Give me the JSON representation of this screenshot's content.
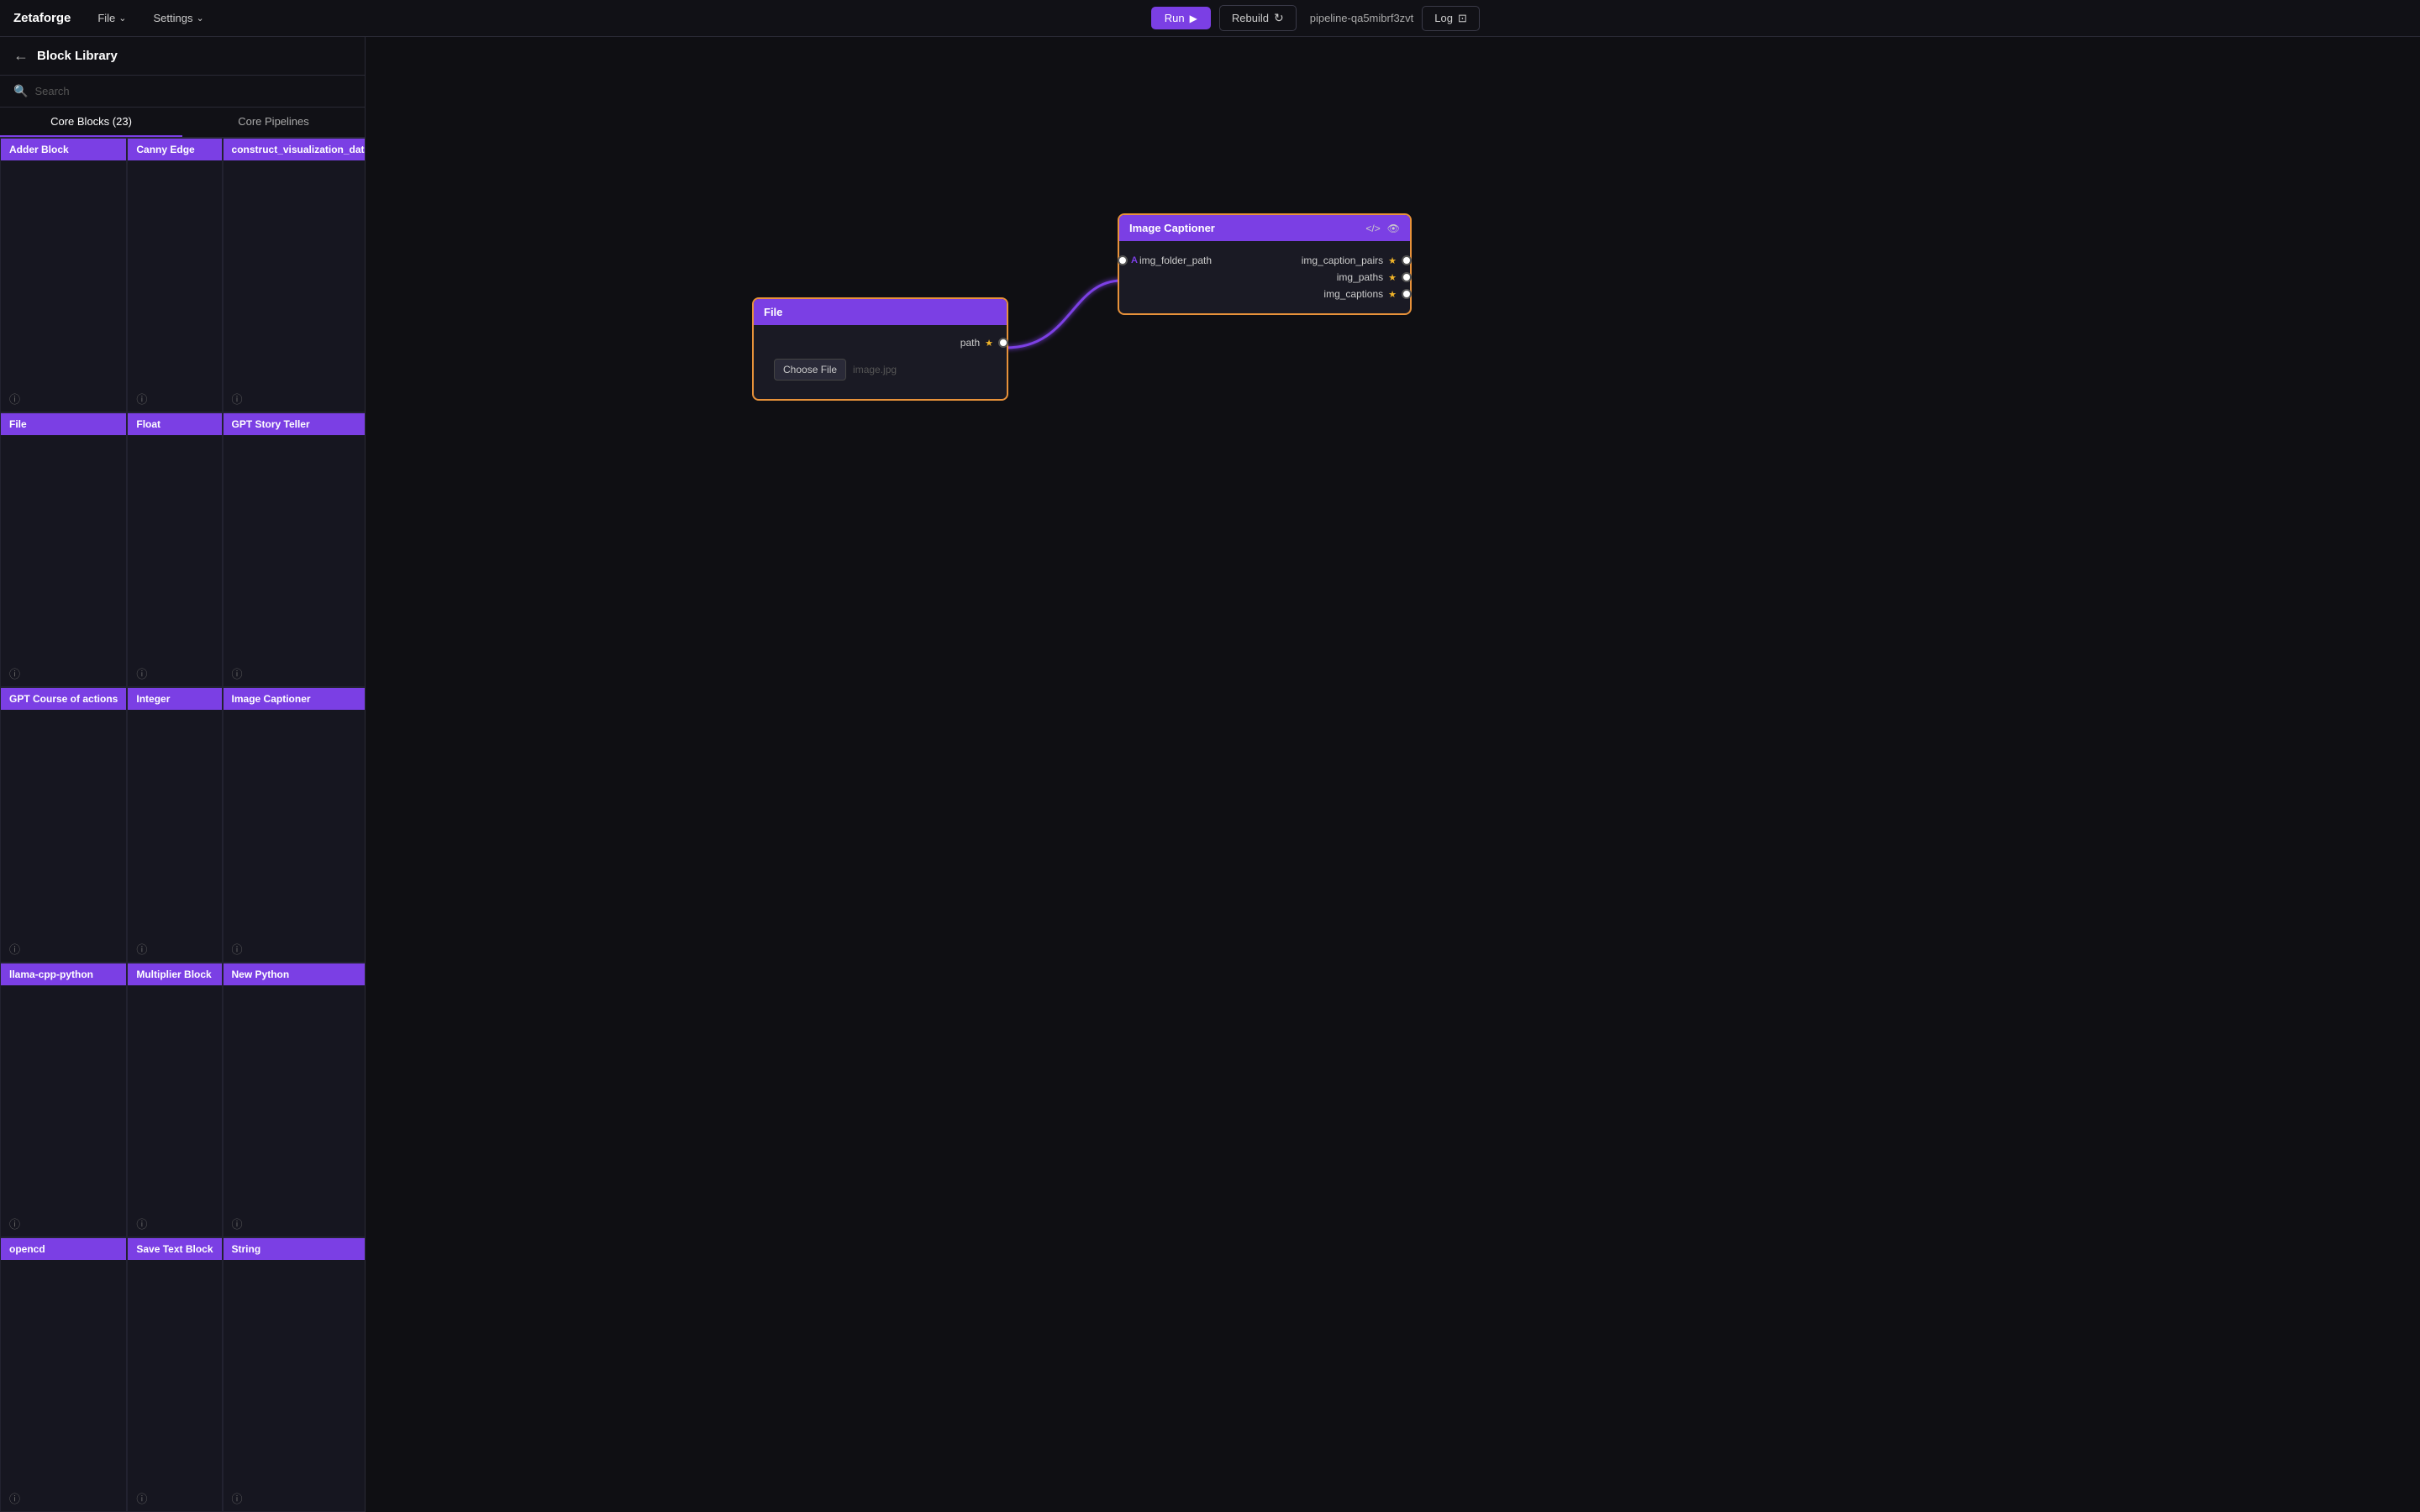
{
  "app": {
    "brand": "Zetaforge",
    "pipeline_name": "pipeline-qa5mibrf3zvt"
  },
  "topbar": {
    "file_label": "File",
    "settings_label": "Settings",
    "run_label": "Run",
    "rebuild_label": "Rebuild",
    "log_label": "Log"
  },
  "sidebar": {
    "title": "Block Library",
    "search_placeholder": "Search",
    "tabs": [
      {
        "label": "Core Blocks (23)",
        "active": true
      },
      {
        "label": "Core Pipelines",
        "active": false
      }
    ],
    "blocks": [
      {
        "title": "Adder Block"
      },
      {
        "title": "Canny Edge"
      },
      {
        "title": "construct_visualization_data"
      },
      {
        "title": "File"
      },
      {
        "title": "Float"
      },
      {
        "title": "GPT Story Teller"
      },
      {
        "title": "GPT Course of actions"
      },
      {
        "title": "Integer"
      },
      {
        "title": "Image Captioner"
      },
      {
        "title": "llama-cpp-python"
      },
      {
        "title": "Multiplier Block"
      },
      {
        "title": "New Python"
      },
      {
        "title": "opencd"
      },
      {
        "title": "Save Text Block"
      },
      {
        "title": "String"
      }
    ]
  },
  "canvas": {
    "file_node": {
      "title": "File",
      "port_path_label": "path",
      "file_btn": "Choose File",
      "file_placeholder": "image.jpg"
    },
    "caption_node": {
      "title": "Image Captioner",
      "ports_in": [
        {
          "label": "img_folder_path",
          "type": "A"
        }
      ],
      "ports_out": [
        {
          "label": "img_caption_pairs",
          "starred": true
        },
        {
          "label": "img_paths",
          "starred": true
        },
        {
          "label": "img_captions",
          "starred": true
        }
      ]
    }
  },
  "icons": {
    "back": "←",
    "search": "🔍",
    "info": "ⓘ",
    "play": "▶",
    "rebuild": "↻",
    "log": "⊡",
    "chevron_down": "⌄",
    "code": "</>",
    "eye": "👁",
    "star": "★"
  }
}
